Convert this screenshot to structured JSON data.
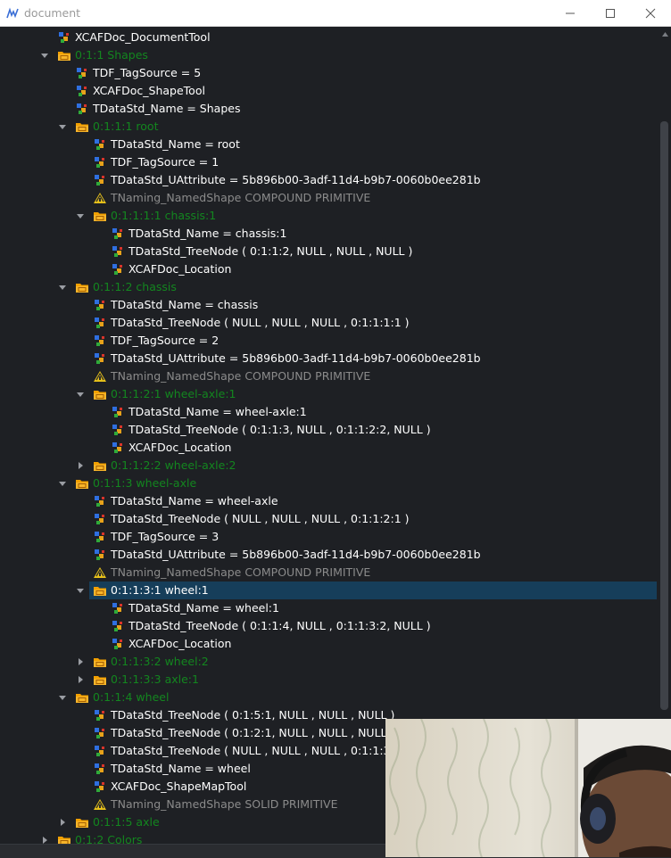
{
  "window": {
    "title": "document",
    "buttons": [
      "minimize",
      "maximize",
      "close"
    ]
  },
  "colors": {
    "background": "#1e2024",
    "text_default": "#ffffff",
    "text_label": "#13861f",
    "text_shape": "#8b8b8b",
    "selection": "#163e5a",
    "folder": "#f2a000"
  },
  "tree": [
    {
      "depth": 1,
      "icon": "attribute-icon",
      "text": "XCAFDoc_DocumentTool",
      "style": "white"
    },
    {
      "depth": 1,
      "icon": "folder-icon",
      "text": "0:1:1 Shapes",
      "style": "green",
      "expanded": true
    },
    {
      "depth": 2,
      "icon": "attribute-icon",
      "text": "TDF_TagSource = 5",
      "style": "white"
    },
    {
      "depth": 2,
      "icon": "attribute-icon",
      "text": "XCAFDoc_ShapeTool",
      "style": "white"
    },
    {
      "depth": 2,
      "icon": "attribute-icon",
      "text": "TDataStd_Name = Shapes",
      "style": "white"
    },
    {
      "depth": 2,
      "icon": "folder-icon",
      "text": "0:1:1:1 root",
      "style": "green",
      "expanded": true
    },
    {
      "depth": 3,
      "icon": "attribute-icon",
      "text": "TDataStd_Name = root",
      "style": "white"
    },
    {
      "depth": 3,
      "icon": "attribute-icon",
      "text": "TDF_TagSource = 1",
      "style": "white"
    },
    {
      "depth": 3,
      "icon": "attribute-icon",
      "text": "TDataStd_UAttribute = 5b896b00-3adf-11d4-b9b7-0060b0ee281b",
      "style": "white"
    },
    {
      "depth": 3,
      "icon": "named-shape-icon",
      "text": "TNaming_NamedShape COMPOUND PRIMITIVE",
      "style": "gray"
    },
    {
      "depth": 3,
      "icon": "folder-icon",
      "text": "0:1:1:1:1 chassis:1",
      "style": "green",
      "expanded": true
    },
    {
      "depth": 4,
      "icon": "attribute-icon",
      "text": "TDataStd_Name = chassis:1",
      "style": "white"
    },
    {
      "depth": 4,
      "icon": "attribute-icon",
      "text": "TDataStd_TreeNode ( 0:1:1:2, NULL , NULL , NULL  )",
      "style": "white"
    },
    {
      "depth": 4,
      "icon": "attribute-icon",
      "text": "XCAFDoc_Location",
      "style": "white"
    },
    {
      "depth": 2,
      "icon": "folder-icon",
      "text": "0:1:1:2 chassis",
      "style": "green",
      "expanded": true
    },
    {
      "depth": 3,
      "icon": "attribute-icon",
      "text": "TDataStd_Name = chassis",
      "style": "white"
    },
    {
      "depth": 3,
      "icon": "attribute-icon",
      "text": "TDataStd_TreeNode ( NULL , NULL , NULL , 0:1:1:1:1 )",
      "style": "white"
    },
    {
      "depth": 3,
      "icon": "attribute-icon",
      "text": "TDF_TagSource = 2",
      "style": "white"
    },
    {
      "depth": 3,
      "icon": "attribute-icon",
      "text": "TDataStd_UAttribute = 5b896b00-3adf-11d4-b9b7-0060b0ee281b",
      "style": "white"
    },
    {
      "depth": 3,
      "icon": "named-shape-icon",
      "text": "TNaming_NamedShape COMPOUND PRIMITIVE",
      "style": "gray"
    },
    {
      "depth": 3,
      "icon": "folder-icon",
      "text": "0:1:1:2:1 wheel-axle:1",
      "style": "green",
      "expanded": true
    },
    {
      "depth": 4,
      "icon": "attribute-icon",
      "text": "TDataStd_Name = wheel-axle:1",
      "style": "white"
    },
    {
      "depth": 4,
      "icon": "attribute-icon",
      "text": "TDataStd_TreeNode ( 0:1:1:3, NULL , 0:1:1:2:2, NULL  )",
      "style": "white"
    },
    {
      "depth": 4,
      "icon": "attribute-icon",
      "text": "XCAFDoc_Location",
      "style": "white"
    },
    {
      "depth": 3,
      "icon": "folder-icon",
      "text": "0:1:1:2:2 wheel-axle:2",
      "style": "green",
      "expanded": false
    },
    {
      "depth": 2,
      "icon": "folder-icon",
      "text": "0:1:1:3 wheel-axle",
      "style": "green",
      "expanded": true
    },
    {
      "depth": 3,
      "icon": "attribute-icon",
      "text": "TDataStd_Name = wheel-axle",
      "style": "white"
    },
    {
      "depth": 3,
      "icon": "attribute-icon",
      "text": "TDataStd_TreeNode ( NULL , NULL , NULL , 0:1:1:2:1 )",
      "style": "white"
    },
    {
      "depth": 3,
      "icon": "attribute-icon",
      "text": "TDF_TagSource = 3",
      "style": "white"
    },
    {
      "depth": 3,
      "icon": "attribute-icon",
      "text": "TDataStd_UAttribute = 5b896b00-3adf-11d4-b9b7-0060b0ee281b",
      "style": "white"
    },
    {
      "depth": 3,
      "icon": "named-shape-icon",
      "text": "TNaming_NamedShape COMPOUND PRIMITIVE",
      "style": "gray"
    },
    {
      "depth": 3,
      "icon": "folder-icon",
      "text": "0:1:1:3:1 wheel:1",
      "style": "white",
      "expanded": true,
      "selected": true
    },
    {
      "depth": 4,
      "icon": "attribute-icon",
      "text": "TDataStd_Name = wheel:1",
      "style": "white"
    },
    {
      "depth": 4,
      "icon": "attribute-icon",
      "text": "TDataStd_TreeNode ( 0:1:1:4, NULL , 0:1:1:3:2, NULL  )",
      "style": "white"
    },
    {
      "depth": 4,
      "icon": "attribute-icon",
      "text": "XCAFDoc_Location",
      "style": "white"
    },
    {
      "depth": 3,
      "icon": "folder-icon",
      "text": "0:1:1:3:2 wheel:2",
      "style": "green",
      "expanded": false
    },
    {
      "depth": 3,
      "icon": "folder-icon",
      "text": "0:1:1:3:3 axle:1",
      "style": "green",
      "expanded": false
    },
    {
      "depth": 2,
      "icon": "folder-icon",
      "text": "0:1:1:4 wheel",
      "style": "green",
      "expanded": true
    },
    {
      "depth": 3,
      "icon": "attribute-icon",
      "text": "TDataStd_TreeNode ( 0:1:5:1, NULL , NULL , NULL  )",
      "style": "white"
    },
    {
      "depth": 3,
      "icon": "attribute-icon",
      "text": "TDataStd_TreeNode ( 0:1:2:1, NULL , NULL , NULL  )",
      "style": "white"
    },
    {
      "depth": 3,
      "icon": "attribute-icon",
      "text": "TDataStd_TreeNode ( NULL , NULL , NULL , 0:1:1:3:1",
      "style": "white"
    },
    {
      "depth": 3,
      "icon": "attribute-icon",
      "text": "TDataStd_Name = wheel",
      "style": "white"
    },
    {
      "depth": 3,
      "icon": "attribute-icon",
      "text": "XCAFDoc_ShapeMapTool",
      "style": "white"
    },
    {
      "depth": 3,
      "icon": "named-shape-icon",
      "text": "TNaming_NamedShape SOLID PRIMITIVE",
      "style": "gray"
    },
    {
      "depth": 2,
      "icon": "folder-icon",
      "text": "0:1:1:5 axle",
      "style": "green",
      "expanded": false
    },
    {
      "depth": 1,
      "icon": "folder-icon",
      "text": "0:1:2 Colors",
      "style": "green",
      "expanded": false
    }
  ]
}
